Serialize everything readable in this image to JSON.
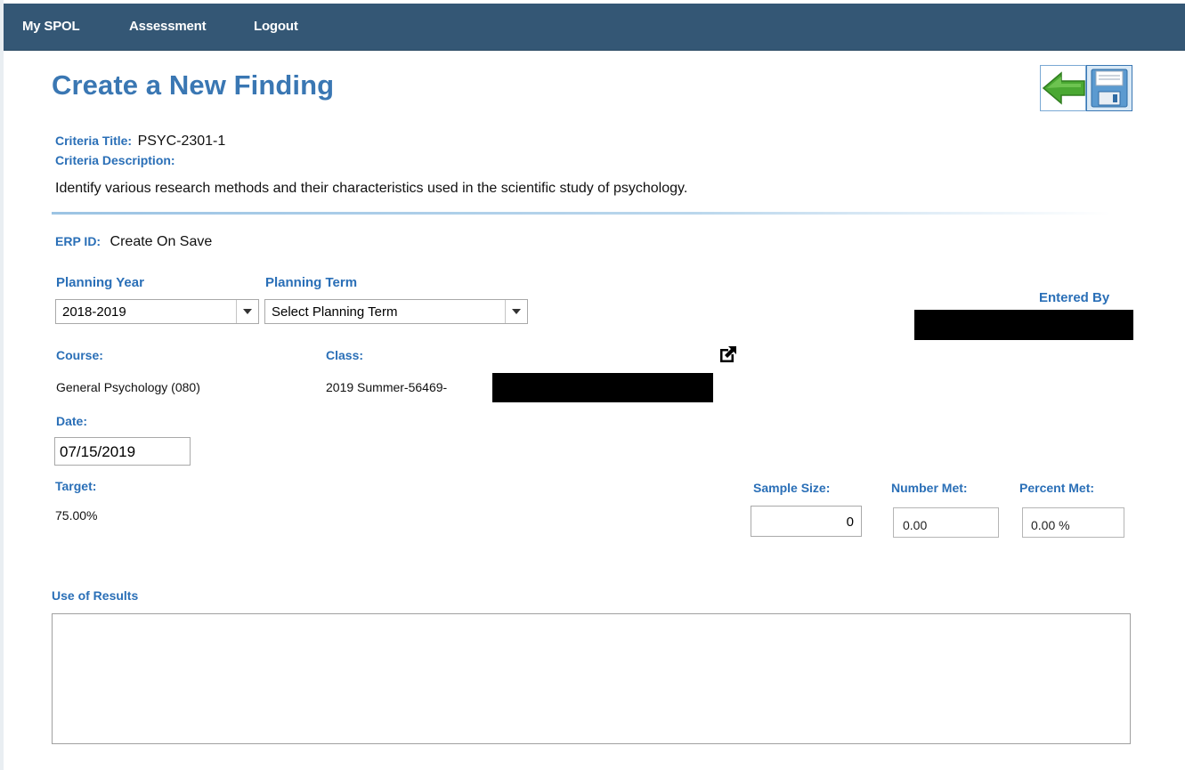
{
  "nav": {
    "items": [
      "My SPOL",
      "Assessment",
      "Logout"
    ]
  },
  "page": {
    "title": "Create a New Finding"
  },
  "criteria": {
    "title_label": "Criteria Title:",
    "title_value": "PSYC-2301-1",
    "description_label": "Criteria Description:",
    "description_value": "Identify various research methods and their characteristics used in the scientific study of psychology."
  },
  "erp": {
    "label": "ERP ID:",
    "value": "Create On Save"
  },
  "planning_year": {
    "label": "Planning Year",
    "value": "2018-2019"
  },
  "planning_term": {
    "label": "Planning Term",
    "value": "Select Planning Term"
  },
  "entered_by": {
    "label": "Entered By"
  },
  "course": {
    "label": "Course:",
    "value": "General Psychology (080)"
  },
  "class": {
    "label": "Class:",
    "value": "2019 Summer-56469-"
  },
  "date": {
    "label": "Date:",
    "value": "07/15/2019"
  },
  "target": {
    "label": "Target:",
    "value": "75.00%"
  },
  "sample_size": {
    "label": "Sample Size:",
    "value": "0"
  },
  "number_met": {
    "label": "Number Met:",
    "value": "0.00"
  },
  "percent_met": {
    "label": "Percent Met:",
    "value": "0.00 %"
  },
  "use_of_results": {
    "label": "Use of Results",
    "value": ""
  },
  "icons": {
    "back": "back-arrow-icon",
    "save": "save-icon",
    "external_link": "external-link-icon"
  },
  "colors": {
    "nav_bg": "#345775",
    "title": "#3a77b3",
    "label": "#2a6fb7",
    "back_arrow": "#4aa832"
  }
}
